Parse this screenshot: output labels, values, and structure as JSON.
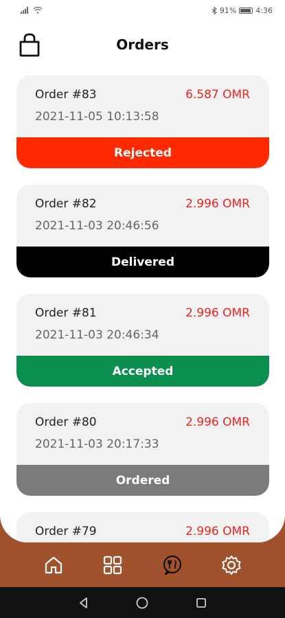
{
  "status_bar": {
    "battery_percent": "91%",
    "time": "4:36"
  },
  "header": {
    "title": "Orders"
  },
  "orders": [
    {
      "number": "Order #83",
      "price": "6.587 OMR",
      "date": "2021-11-05 10:13:58",
      "status": "Rejected",
      "status_color": "#ff2a00"
    },
    {
      "number": "Order #82",
      "price": "2.996 OMR",
      "date": "2021-11-03 20:46:56",
      "status": "Delivered",
      "status_color": "#000000"
    },
    {
      "number": "Order #81",
      "price": "2.996 OMR",
      "date": "2021-11-03 20:46:34",
      "status": "Accepted",
      "status_color": "#0a8f4f"
    },
    {
      "number": "Order #80",
      "price": "2.996 OMR",
      "date": "2021-11-03 20:17:33",
      "status": "Ordered",
      "status_color": "#7b7b7b"
    },
    {
      "number": "Order #79",
      "price": "2.996 OMR",
      "date": "",
      "status": "",
      "status_color": "#7b7b7b"
    }
  ],
  "bottom_nav": {
    "items": [
      {
        "icon": "home-icon"
      },
      {
        "icon": "grid-icon"
      },
      {
        "icon": "menu-food-icon"
      },
      {
        "icon": "settings-icon"
      }
    ]
  },
  "colors": {
    "accent": "#e8261f",
    "nav_background": "#a0522d"
  }
}
